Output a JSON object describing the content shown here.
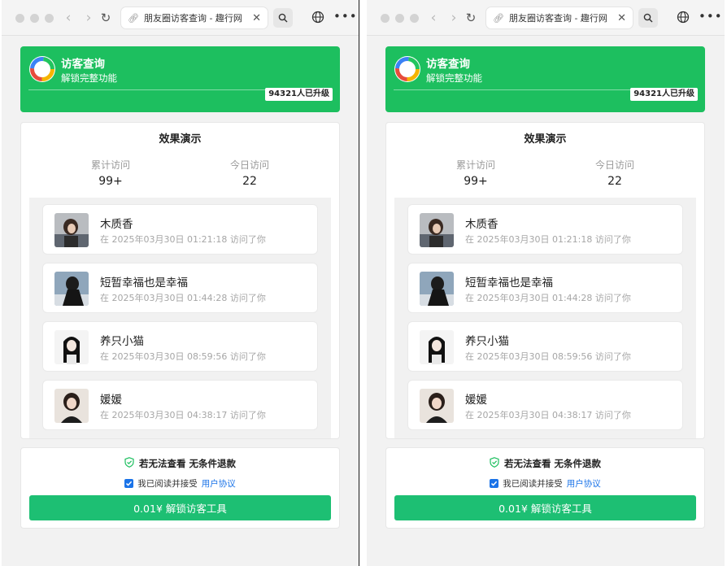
{
  "browser": {
    "tab_title": "朋友圈访客查询 - 趣行网"
  },
  "hero": {
    "title": "访客查询",
    "subtitle": "解锁完整功能",
    "badge": "94321人已升级"
  },
  "demo": {
    "title": "效果演示",
    "stats": {
      "total_label": "累计访问",
      "total_value": "99+",
      "today_label": "今日访问",
      "today_value": "22"
    },
    "visitors": [
      {
        "name": "木质香",
        "time": "在 2025年03月30日 01:21:18 访问了你"
      },
      {
        "name": "短暂幸福也是幸福",
        "time": "在 2025年03月30日 01:44:28 访问了你"
      },
      {
        "name": "养只小猫",
        "time": "在 2025年03月30日 08:59:56 访问了你"
      },
      {
        "name": "媛媛",
        "time": "在 2025年03月30日 04:38:17 访问了你"
      }
    ]
  },
  "footer": {
    "guarantee": "若无法查看 无条件退款",
    "agree_text": "我已阅读并接受",
    "agree_link": "用户协议",
    "cta": "0.01¥ 解锁访客工具"
  },
  "colors": {
    "brand_green": "#1dbf5f",
    "cta_green": "#1dbf73",
    "link_blue": "#1a73e8"
  }
}
